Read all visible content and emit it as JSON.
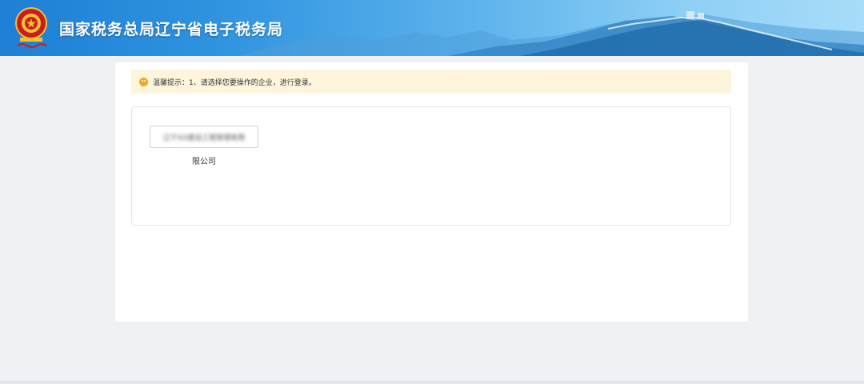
{
  "header": {
    "title": "国家税务总局辽宁省电子税务局",
    "emblem_icon": "tax-emblem-icon",
    "colors": {
      "bar_left": "#1e7fd4",
      "bar_right": "#a8dcf8"
    }
  },
  "notice": {
    "icon": "smile-icon",
    "text": "温馨提示：1、请选择您要操作的企业，进行登录。",
    "color": "#fdf6dc"
  },
  "companies": [
    {
      "name_blurred": "辽宁XX建设工程管理有限",
      "name_suffix": "限公司"
    }
  ]
}
